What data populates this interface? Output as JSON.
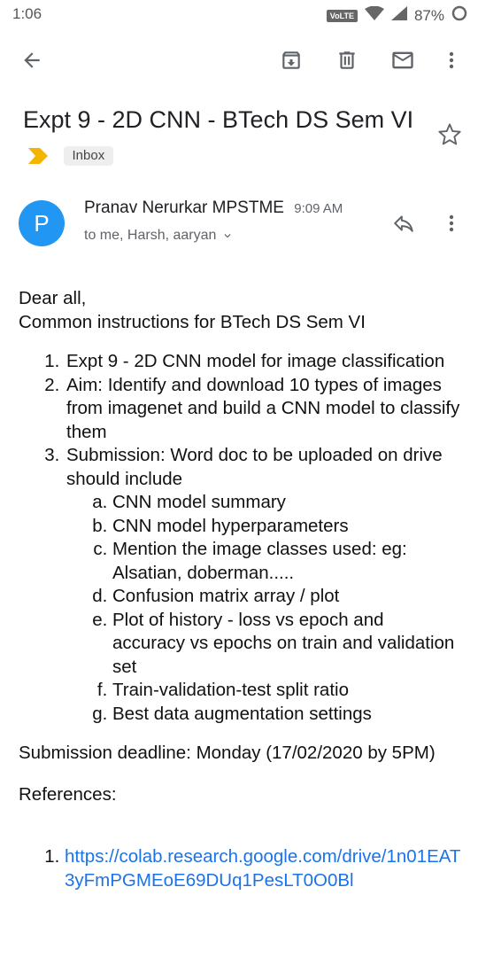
{
  "status_bar": {
    "time": "1:06",
    "network_badge": "VoLTE",
    "battery": "87%"
  },
  "toolbar": {
    "icons": [
      "back-arrow-icon",
      "archive-icon",
      "delete-icon",
      "mark-unread-icon",
      "more-vert-icon"
    ]
  },
  "email": {
    "subject": "Expt 9 - 2D CNN - BTech DS Sem VI",
    "label": "Inbox",
    "sender": {
      "initial": "P",
      "name": "Pranav Nerurkar MPSTME",
      "time": "9:09 AM",
      "recipients": "to me, Harsh, aaryan"
    },
    "body": {
      "greeting": "Dear all,",
      "intro": "Common instructions for BTech DS Sem VI",
      "items": [
        "Expt 9 - 2D CNN model for image classification",
        "Aim: Identify and download 10 types of images from imagenet and build a CNN model to classify them",
        "Submission: Word doc to be uploaded on drive should include"
      ],
      "sub_items": [
        "CNN model summary",
        "CNN model hyperparameters",
        "Mention the image classes used: eg: Alsatian, doberman.....",
        "Confusion matrix array / plot",
        "Plot of history - loss vs epoch and accuracy vs epochs on train and validation set",
        "Train-validation-test split ratio",
        "Best data augmentation settings"
      ],
      "deadline": "Submission deadline: Monday (17/02/2020 by 5PM)",
      "references_heading": "References:",
      "references": [
        "https://colab.research.google.com/drive/1n01EAT3yFmPGMEoE69DUq1PesLT0O0Bl"
      ]
    }
  },
  "colors": {
    "avatar": "#2196f3",
    "link": "#1a73e8",
    "importance_marker": "#f4b400"
  }
}
